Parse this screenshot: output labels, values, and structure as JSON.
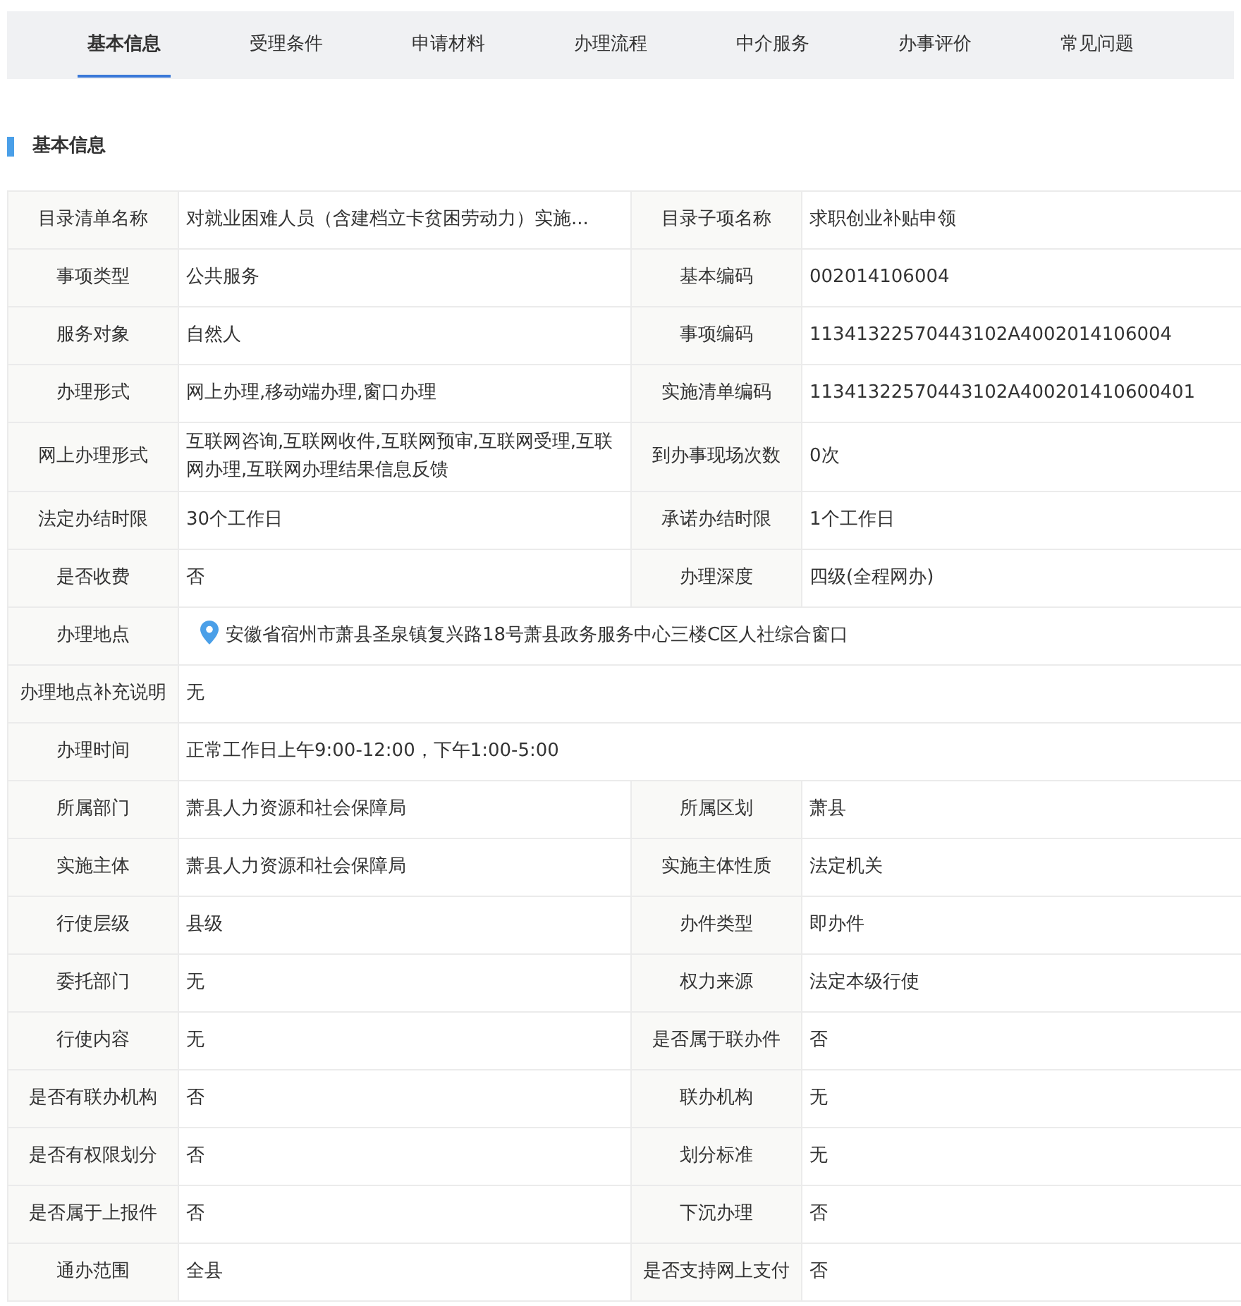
{
  "tabs": [
    {
      "label": "基本信息",
      "selected": true
    },
    {
      "label": "受理条件",
      "selected": false
    },
    {
      "label": "申请材料",
      "selected": false
    },
    {
      "label": "办理流程",
      "selected": false
    },
    {
      "label": "中介服务",
      "selected": false
    },
    {
      "label": "办事评价",
      "selected": false
    },
    {
      "label": "常见问题",
      "selected": false
    }
  ],
  "section_title": "基本信息",
  "table": {
    "rows": [
      {
        "cells": [
          {
            "kind": "label",
            "text": "目录清单名称"
          },
          {
            "kind": "value",
            "text": "对就业困难人员（含建档立卡贫困劳动力）实施..."
          },
          {
            "kind": "label",
            "text": "目录子项名称"
          },
          {
            "kind": "value",
            "text": "求职创业补贴申领"
          }
        ]
      },
      {
        "cells": [
          {
            "kind": "label",
            "text": "事项类型"
          },
          {
            "kind": "value",
            "text": "公共服务"
          },
          {
            "kind": "label",
            "text": "基本编码"
          },
          {
            "kind": "value",
            "text": "002014106004"
          }
        ]
      },
      {
        "cells": [
          {
            "kind": "label",
            "text": "服务对象"
          },
          {
            "kind": "value",
            "text": "自然人"
          },
          {
            "kind": "label",
            "text": "事项编码"
          },
          {
            "kind": "value",
            "text": "11341322570443102A4002014106004"
          }
        ]
      },
      {
        "cells": [
          {
            "kind": "label",
            "text": "办理形式"
          },
          {
            "kind": "value",
            "text": "网上办理,移动端办理,窗口办理"
          },
          {
            "kind": "label",
            "text": "实施清单编码"
          },
          {
            "kind": "value",
            "text": "11341322570443102A400201410600401"
          }
        ]
      },
      {
        "cells": [
          {
            "kind": "label",
            "text": "网上办理形式"
          },
          {
            "kind": "value",
            "text": "互联网咨询,互联网收件,互联网预审,互联网受理,互联网办理,互联网办理结果信息反馈"
          },
          {
            "kind": "label",
            "text": "到办事现场次数"
          },
          {
            "kind": "value",
            "text": "0次"
          }
        ]
      },
      {
        "cells": [
          {
            "kind": "label",
            "text": "法定办结时限"
          },
          {
            "kind": "value",
            "text": "30个工作日"
          },
          {
            "kind": "label",
            "text": "承诺办结时限"
          },
          {
            "kind": "value",
            "text": "1个工作日"
          }
        ]
      },
      {
        "cells": [
          {
            "kind": "label",
            "text": "是否收费"
          },
          {
            "kind": "value",
            "text": "否"
          },
          {
            "kind": "label",
            "text": "办理深度"
          },
          {
            "kind": "value",
            "text": "四级(全程网办)"
          }
        ]
      },
      {
        "cells": [
          {
            "kind": "label",
            "text": "办理地点"
          },
          {
            "kind": "location",
            "colspan": 3,
            "text": "安徽省宿州市萧县圣泉镇复兴路18号萧县政务服务中心三楼C区人社综合窗口"
          }
        ]
      },
      {
        "cells": [
          {
            "kind": "label",
            "text": "办理地点补充说明"
          },
          {
            "kind": "value",
            "colspan": 3,
            "text": "无"
          }
        ]
      },
      {
        "cells": [
          {
            "kind": "label",
            "text": "办理时间"
          },
          {
            "kind": "value",
            "colspan": 3,
            "text": "正常工作日上午9:00-12:00，下午1:00-5:00"
          }
        ]
      },
      {
        "cells": [
          {
            "kind": "label",
            "text": "所属部门"
          },
          {
            "kind": "value",
            "text": "萧县人力资源和社会保障局"
          },
          {
            "kind": "label",
            "text": "所属区划"
          },
          {
            "kind": "value",
            "text": "萧县"
          }
        ]
      },
      {
        "cells": [
          {
            "kind": "label",
            "text": "实施主体"
          },
          {
            "kind": "value",
            "text": "萧县人力资源和社会保障局"
          },
          {
            "kind": "label",
            "text": "实施主体性质"
          },
          {
            "kind": "value",
            "text": "法定机关"
          }
        ]
      },
      {
        "cells": [
          {
            "kind": "label",
            "text": "行使层级"
          },
          {
            "kind": "value",
            "text": "县级"
          },
          {
            "kind": "label",
            "text": "办件类型"
          },
          {
            "kind": "value",
            "text": "即办件"
          }
        ]
      },
      {
        "cells": [
          {
            "kind": "label",
            "text": "委托部门"
          },
          {
            "kind": "value",
            "text": "无"
          },
          {
            "kind": "label",
            "text": "权力来源"
          },
          {
            "kind": "value",
            "text": "法定本级行使"
          }
        ]
      },
      {
        "cells": [
          {
            "kind": "label",
            "text": "行使内容"
          },
          {
            "kind": "value",
            "text": "无"
          },
          {
            "kind": "label",
            "text": "是否属于联办件"
          },
          {
            "kind": "value",
            "text": "否"
          }
        ]
      },
      {
        "cells": [
          {
            "kind": "label",
            "text": "是否有联办机构"
          },
          {
            "kind": "value",
            "text": "否"
          },
          {
            "kind": "label",
            "text": "联办机构"
          },
          {
            "kind": "value",
            "text": "无"
          }
        ]
      },
      {
        "cells": [
          {
            "kind": "label",
            "text": "是否有权限划分"
          },
          {
            "kind": "value",
            "text": "否"
          },
          {
            "kind": "label",
            "text": "划分标准"
          },
          {
            "kind": "value",
            "text": "无"
          }
        ]
      },
      {
        "cells": [
          {
            "kind": "label",
            "text": "是否属于上报件"
          },
          {
            "kind": "value",
            "text": "否"
          },
          {
            "kind": "label",
            "text": "下沉办理"
          },
          {
            "kind": "value",
            "text": "否"
          }
        ]
      },
      {
        "cells": [
          {
            "kind": "label",
            "text": "通办范围"
          },
          {
            "kind": "value",
            "text": "全县"
          },
          {
            "kind": "label",
            "text": "是否支持网上支付"
          },
          {
            "kind": "value",
            "text": "否"
          }
        ]
      }
    ]
  }
}
